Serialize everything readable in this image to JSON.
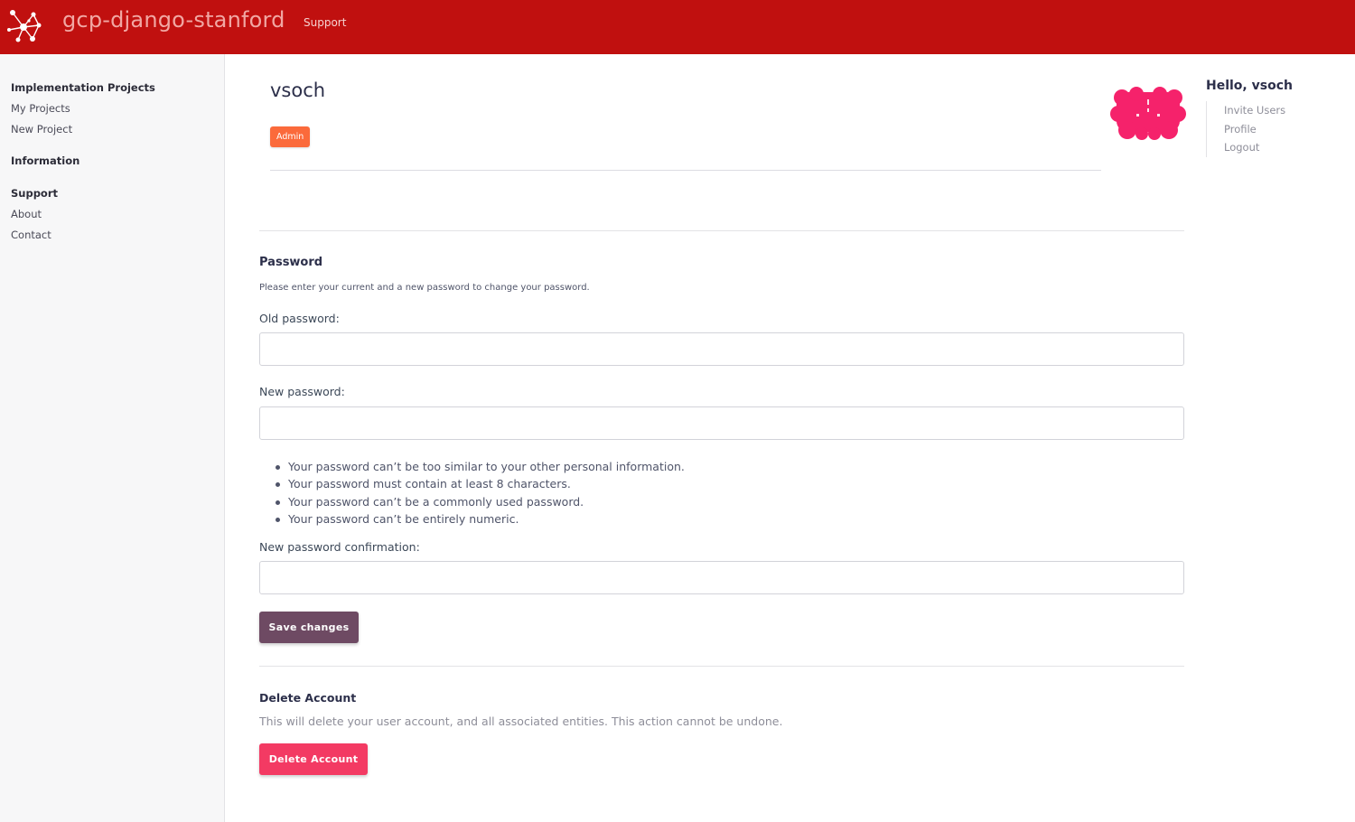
{
  "app": {
    "brand": "gcp-django-stanford",
    "nav_support": "Support",
    "logo_icon": "network-graph-icon",
    "colors": {
      "topbar": "#c0100f",
      "badge": "#fb6a3b",
      "save_button": "#6e4a63",
      "delete_button": "#f33a63",
      "avatar": "#f5226b"
    }
  },
  "sidebar": {
    "sections": [
      {
        "heading": "Implementation Projects",
        "items": [
          "My Projects",
          "New Project"
        ]
      },
      {
        "heading": "Information",
        "items": []
      },
      {
        "heading": "Support",
        "items": [
          "About",
          "Contact"
        ]
      }
    ]
  },
  "profile": {
    "username": "vsoch",
    "badge": "Admin"
  },
  "user_menu": {
    "greeting": "Hello, vsoch",
    "items": [
      "Invite Users",
      "Profile",
      "Logout"
    ]
  },
  "password": {
    "title": "Password",
    "help": "Please enter your current and a new password to change your password.",
    "old_label": "Old password:",
    "old_value": "",
    "new_label": "New password:",
    "new_value": "",
    "rules": [
      "Your password can’t be too similar to your other personal information.",
      "Your password must contain at least 8 characters.",
      "Your password can’t be a commonly used password.",
      "Your password can’t be entirely numeric."
    ],
    "confirm_label": "New password confirmation:",
    "confirm_value": "",
    "save_button": "Save changes"
  },
  "delete_account": {
    "title": "Delete Account",
    "text": "This will delete your user account, and all associated entities. This action cannot be undone.",
    "button": "Delete Account"
  }
}
